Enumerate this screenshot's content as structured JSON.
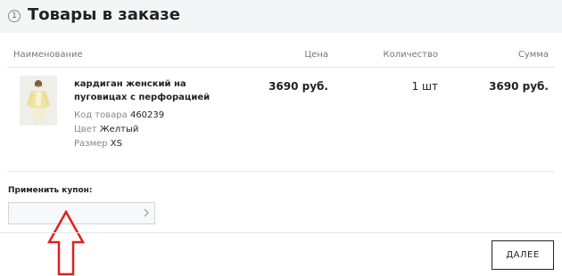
{
  "header": {
    "step": "1",
    "title": "Товары в заказе"
  },
  "table": {
    "columns": {
      "name": "Наименование",
      "price": "Цена",
      "qty": "Количество",
      "sum": "Сумма"
    },
    "items": [
      {
        "name": "кардиган женский на пуговицах с перфорацией",
        "code_label": "Код товара",
        "code": "460239",
        "color_label": "Цвет",
        "color": "Желтый",
        "size_label": "Размер",
        "size": "XS",
        "price": "3690 руб.",
        "qty": "1 шт",
        "sum": "3690 руб.",
        "image_icon": "cardigan-product-photo"
      }
    ]
  },
  "coupon": {
    "label": "Применить купон:",
    "value": "",
    "placeholder": ""
  },
  "annotation": {
    "arrow_color": "#e02020"
  },
  "actions": {
    "next_label": "ДАЛЕЕ"
  }
}
